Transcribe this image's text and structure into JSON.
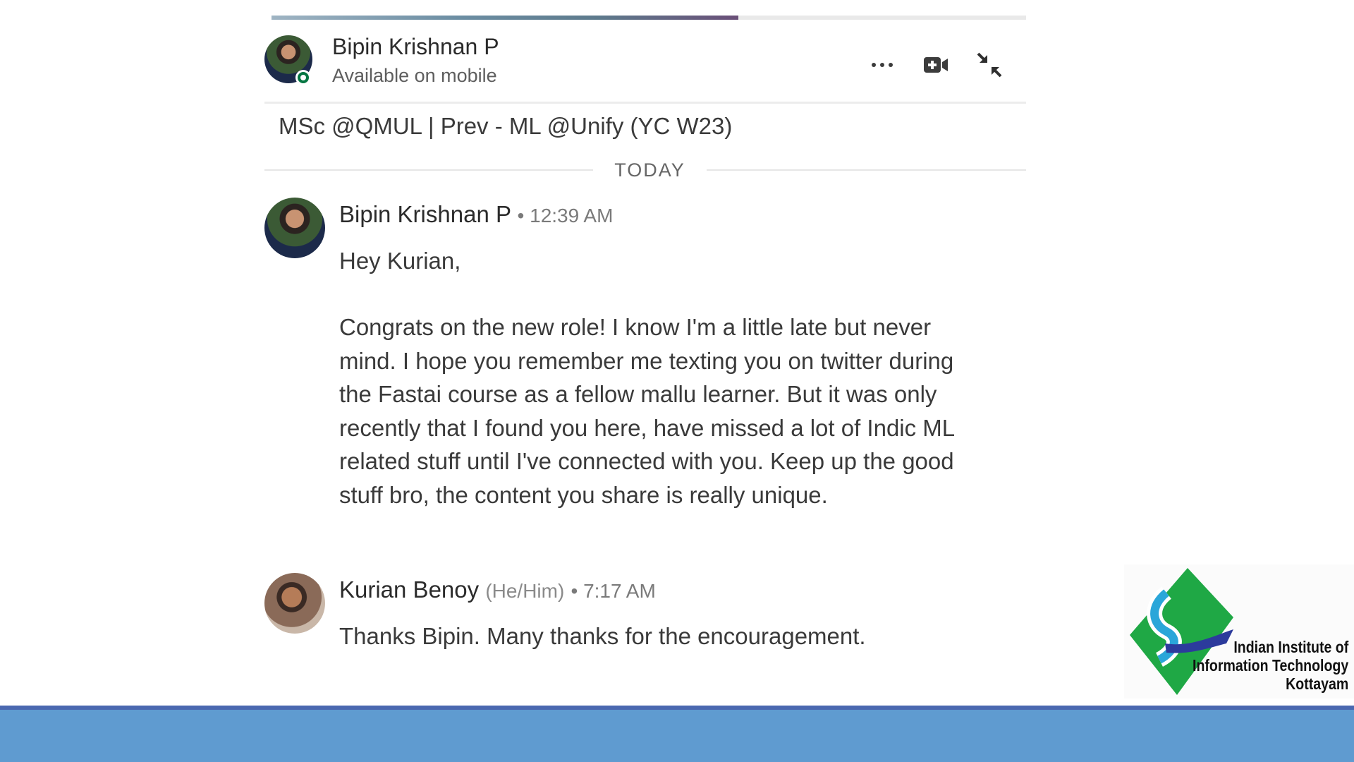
{
  "header": {
    "name": "Bipin Krishnan P",
    "status": "Available on mobile",
    "icons": [
      "more-options-icon",
      "video-call-icon",
      "collapse-icon"
    ]
  },
  "profile": {
    "headline": "MSc @QMUL | Prev - ML @Unify (YC W23)"
  },
  "divider": {
    "label": "TODAY"
  },
  "messages": [
    {
      "sender": "Bipin Krishnan P",
      "time": "• 12:39 AM",
      "greeting": "Hey Kurian,",
      "body": "Congrats on the new role! I know I'm a little late but never mind. I hope you remember me texting you on twitter during the Fastai course as a fellow mallu learner. But it was only recently that I found you here, have missed a lot of Indic ML related stuff until I've connected with you. Keep up the good stuff bro, the content you share is really unique."
    },
    {
      "sender": "Kurian Benoy",
      "pronouns": "(He/Him)",
      "time": "• 7:17 AM",
      "body": "Thanks Bipin. Many thanks for the encouragement."
    }
  ],
  "logo": {
    "line1": "Indian Institute of",
    "line2": "Information Technology",
    "line3": "Kottayam"
  },
  "colors": {
    "online": "#057642",
    "footer": "#5f9bd0",
    "footer_line": "#4a68b0",
    "logo_green": "#1fa845",
    "logo_blue": "#2c3b9c",
    "logo_cyan": "#2aa6d9"
  }
}
